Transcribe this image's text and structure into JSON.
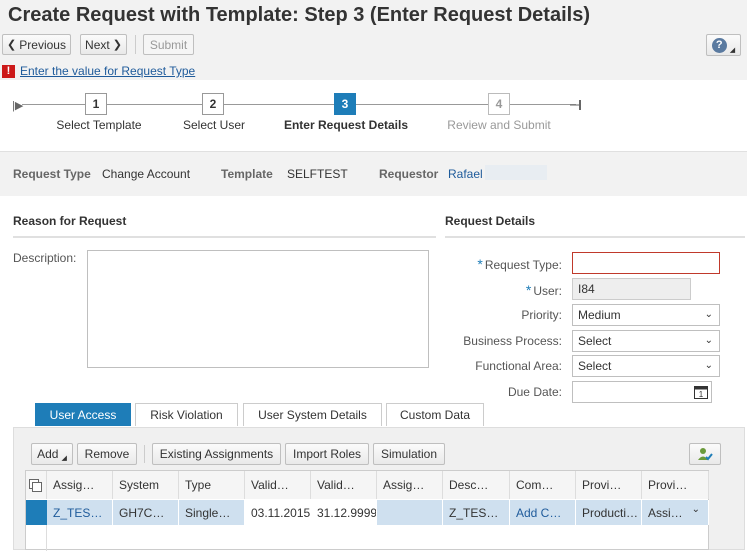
{
  "header": {
    "title": "Create Request with Template: Step 3  (Enter Request Details)",
    "prev_label": "Previous",
    "next_label": "Next",
    "submit_label": "Submit",
    "help_icon": "?"
  },
  "error": {
    "icon": "!",
    "message": "Enter the value for Request Type"
  },
  "steps": [
    {
      "num": "1",
      "label": "Select Template",
      "state": "done"
    },
    {
      "num": "2",
      "label": "Select User",
      "state": "done"
    },
    {
      "num": "3",
      "label": "Enter Request Details",
      "state": "active"
    },
    {
      "num": "4",
      "label": "Review and Submit",
      "state": "future"
    }
  ],
  "info": {
    "request_type_label": "Request Type",
    "request_type_value": "Change Account",
    "template_label": "Template",
    "template_value": "SELFTEST",
    "requestor_label": "Requestor",
    "requestor_value": "Rafael"
  },
  "reason": {
    "heading": "Reason for Request",
    "description_label": "Description:",
    "description_value": ""
  },
  "details": {
    "heading": "Request Details",
    "request_type_label": "Request Type:",
    "request_type_value": "",
    "user_label": "User:",
    "user_value": "I84",
    "priority_label": "Priority:",
    "priority_value": "Medium",
    "business_process_label": "Business Process:",
    "business_process_value": "Select",
    "functional_area_label": "Functional Area:",
    "functional_area_value": "Select",
    "due_date_label": "Due Date:",
    "due_date_value": ""
  },
  "tabs": [
    {
      "label": "User Access",
      "active": true
    },
    {
      "label": "Risk Violation",
      "active": false
    },
    {
      "label": "User System Details",
      "active": false
    },
    {
      "label": "Custom Data",
      "active": false
    }
  ],
  "toolbar": {
    "add_label": "Add",
    "remove_label": "Remove",
    "existing_label": "Existing Assignments",
    "import_label": "Import Roles",
    "simulation_label": "Simulation"
  },
  "table": {
    "columns": [
      "Assig…",
      "System",
      "Type",
      "Valid…",
      "Valid…",
      "Assig…",
      "Desc…",
      "Com…",
      "Provi…",
      "Provi…"
    ],
    "rows": [
      [
        "Z_TES…",
        "GH7C…",
        "Single…",
        "03.11.2015",
        "31.12.9999",
        "",
        "Z_TES…",
        "Add C…",
        "Producti…",
        "Assi…"
      ]
    ]
  }
}
